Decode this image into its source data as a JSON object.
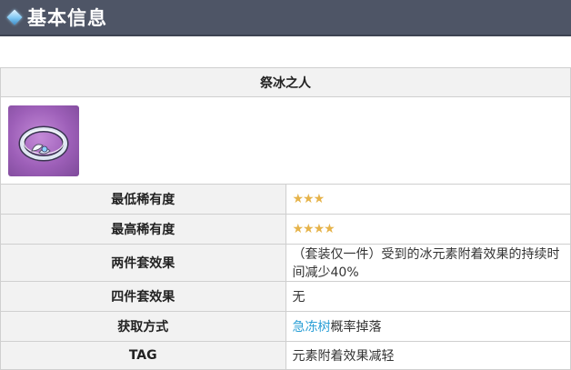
{
  "header": {
    "title": "基本信息",
    "icon": "diamond-icon",
    "background": "#4e5566"
  },
  "item": {
    "name": "祭冰之人",
    "image": "ring-artifact-icon"
  },
  "rows": [
    {
      "label": "最低稀有度",
      "value": "",
      "stars": 3,
      "star_text": "★★★"
    },
    {
      "label": "最高稀有度",
      "value": "",
      "stars": 4,
      "star_text": "★★★★"
    },
    {
      "label": "两件套效果",
      "value": "（套装仅一件）受到的冰元素附着效果的持续时间减少40%"
    },
    {
      "label": "四件套效果",
      "value": "无"
    },
    {
      "label": "获取方式",
      "link": "急冻树",
      "value": "概率掉落"
    },
    {
      "label": "TAG",
      "value": "元素附着效果减轻"
    }
  ],
  "colors": {
    "link": "#2a9fd6",
    "star": "#e6b34a",
    "label_bg": "#f2f2f2"
  }
}
